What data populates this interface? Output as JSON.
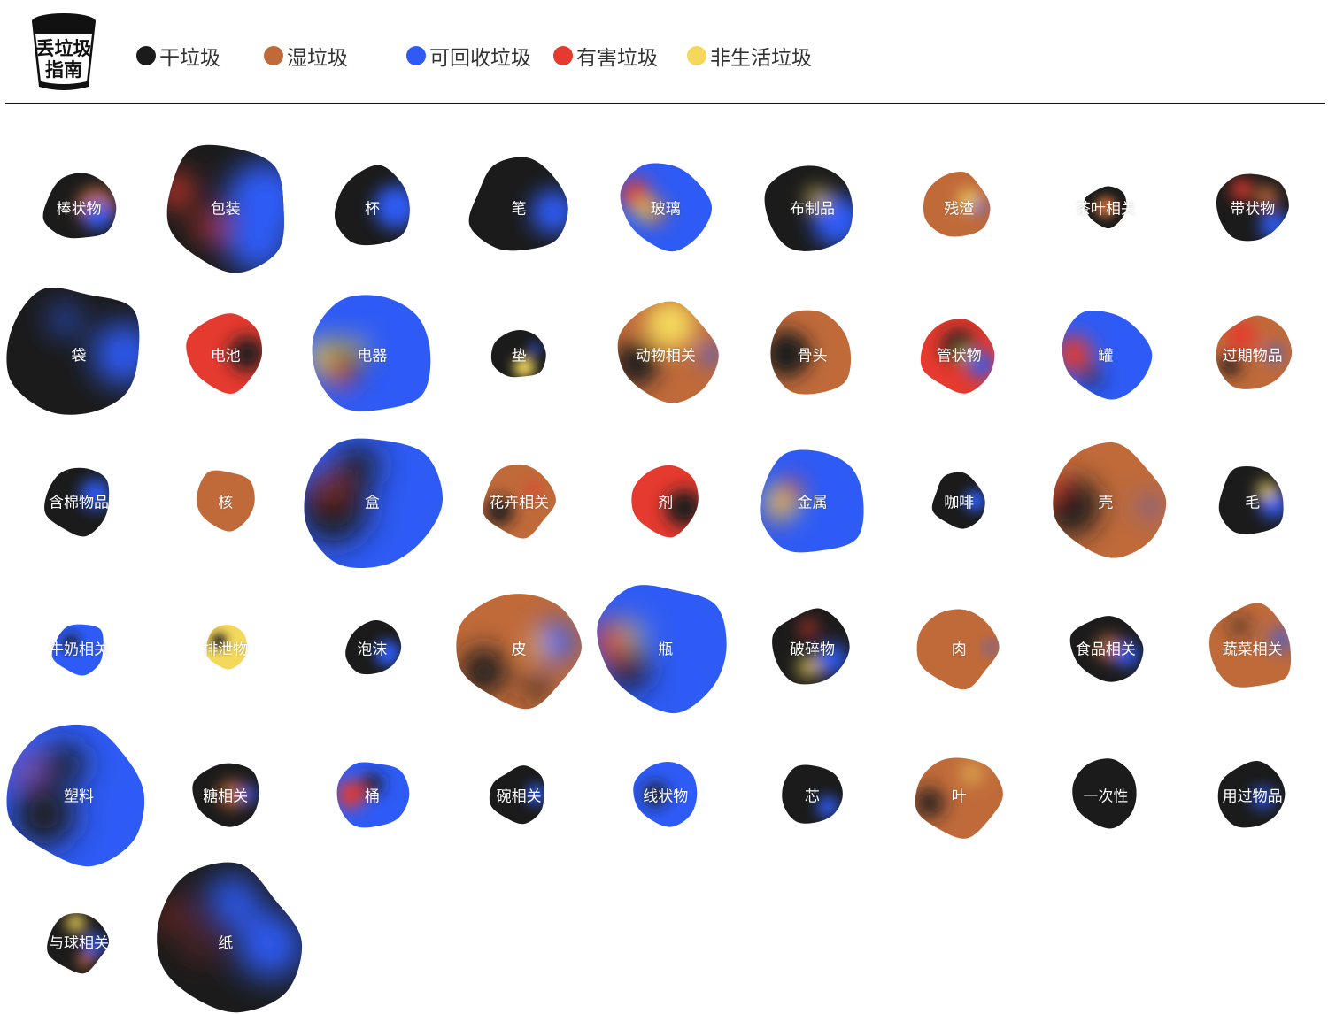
{
  "header": {
    "logo": {
      "line1": "丢垃圾",
      "line2": "指南"
    },
    "legend": [
      {
        "label": "干垃圾",
        "color": "#1b1b1b"
      },
      {
        "label": "湿垃圾",
        "color": "#c06a3a"
      },
      {
        "label": "可回收垃圾",
        "color": "#2e5bf5"
      },
      {
        "label": "有害垃圾",
        "color": "#e53a2f"
      },
      {
        "label": "非生活垃圾",
        "color": "#f4d85c"
      }
    ]
  },
  "colors": {
    "dry": "#1b1b1b",
    "wet": "#c06a3a",
    "recyclable": "#2e5bf5",
    "hazardous": "#e53a2f",
    "non_household": "#f4d85c"
  },
  "items": [
    {
      "label": "棒状物",
      "size": 40,
      "base": "dry",
      "spots": [
        [
          "wet",
          0.5,
          0.0,
          0.55
        ],
        [
          "recyclable",
          0.55,
          0.25,
          0.4
        ]
      ]
    },
    {
      "label": "包装",
      "size": 74,
      "base": "dry",
      "spots": [
        [
          "recyclable",
          0.6,
          -0.1,
          0.6
        ],
        [
          "recyclable",
          0.5,
          0.5,
          0.5
        ],
        [
          "hazardous",
          -0.75,
          -0.25,
          0.25
        ],
        [
          "hazardous",
          -0.25,
          0.3,
          0.2
        ]
      ]
    },
    {
      "label": "杯",
      "size": 45,
      "base": "dry",
      "spots": [
        [
          "recyclable",
          0.6,
          0.0,
          0.55
        ]
      ]
    },
    {
      "label": "笔",
      "size": 56,
      "base": "dry",
      "spots": [
        [
          "recyclable",
          0.7,
          0.1,
          0.45
        ]
      ]
    },
    {
      "label": "玻璃",
      "size": 50,
      "base": "recyclable",
      "spots": [
        [
          "hazardous",
          -0.7,
          -0.3,
          0.35
        ],
        [
          "wet",
          -0.3,
          0.1,
          0.3
        ],
        [
          "non_household",
          -0.5,
          0.05,
          0.2
        ]
      ]
    },
    {
      "label": "布制品",
      "size": 52,
      "base": "dry",
      "spots": [
        [
          "recyclable",
          0.55,
          0.3,
          0.55
        ],
        [
          "non_household",
          0.1,
          -0.2,
          0.2
        ]
      ]
    },
    {
      "label": "残渣",
      "size": 38,
      "base": "wet",
      "spots": [
        [
          "non_household",
          0.3,
          -0.2,
          0.3
        ],
        [
          "recyclable",
          0.6,
          0.0,
          0.2
        ]
      ]
    },
    {
      "label": "茶叶相关",
      "size": 24,
      "base": "dry",
      "spots": [
        [
          "wet",
          0.0,
          0.0,
          0.5
        ]
      ]
    },
    {
      "label": "带状物",
      "size": 40,
      "base": "dry",
      "spots": [
        [
          "hazardous",
          -0.3,
          -0.5,
          0.3
        ],
        [
          "recyclable",
          0.6,
          0.5,
          0.4
        ],
        [
          "wet",
          0.4,
          -0.3,
          0.3
        ]
      ]
    },
    {
      "label": "袋",
      "size": 78,
      "base": "dry",
      "spots": [
        [
          "recyclable",
          0.65,
          0.0,
          0.45
        ],
        [
          "recyclable",
          -0.2,
          -0.5,
          0.2
        ]
      ]
    },
    {
      "label": "电池",
      "size": 45,
      "base": "hazardous",
      "spots": [
        [
          "dry",
          0.55,
          0.0,
          0.45
        ]
      ]
    },
    {
      "label": "电器",
      "size": 68,
      "base": "recyclable",
      "spots": [
        [
          "non_household",
          -0.75,
          0.05,
          0.3
        ],
        [
          "dry",
          -0.45,
          0.1,
          0.3
        ],
        [
          "hazardous",
          -0.55,
          0.35,
          0.2
        ],
        [
          "non_household",
          -0.3,
          -0.1,
          0.15
        ]
      ]
    },
    {
      "label": "垫",
      "size": 30,
      "base": "dry",
      "spots": [
        [
          "non_household",
          0.2,
          0.5,
          0.4
        ],
        [
          "recyclable",
          0.6,
          -0.2,
          0.2
        ]
      ]
    },
    {
      "label": "动物相关",
      "size": 56,
      "base": "wet",
      "spots": [
        [
          "non_household",
          0.1,
          -0.6,
          0.5
        ],
        [
          "dry",
          -0.6,
          0.2,
          0.45
        ],
        [
          "recyclable",
          0.9,
          0.0,
          0.2
        ]
      ]
    },
    {
      "label": "骨头",
      "size": 48,
      "base": "wet",
      "spots": [
        [
          "dry",
          -0.6,
          0.0,
          0.55
        ]
      ]
    },
    {
      "label": "管状物",
      "size": 42,
      "base": "hazardous",
      "spots": [
        [
          "dry",
          0.0,
          -0.2,
          0.45
        ],
        [
          "recyclable",
          0.6,
          0.3,
          0.35
        ],
        [
          "non_household",
          0.15,
          0.0,
          0.15
        ]
      ]
    },
    {
      "label": "罐",
      "size": 52,
      "base": "recyclable",
      "spots": [
        [
          "hazardous",
          -0.7,
          0.0,
          0.4
        ],
        [
          "dry",
          -0.3,
          0.5,
          0.2
        ]
      ]
    },
    {
      "label": "过期物品",
      "size": 42,
      "base": "wet",
      "spots": [
        [
          "hazardous",
          -0.3,
          -0.5,
          0.4
        ],
        [
          "dry",
          -0.6,
          0.3,
          0.3
        ],
        [
          "recyclable",
          0.6,
          0.0,
          0.2
        ]
      ]
    },
    {
      "label": "含棉物品",
      "size": 38,
      "base": "dry",
      "spots": [
        [
          "recyclable",
          0.5,
          -0.2,
          0.45
        ]
      ]
    },
    {
      "label": "核",
      "size": 35,
      "base": "wet",
      "spots": []
    },
    {
      "label": "盒",
      "size": 80,
      "base": "recyclable",
      "spots": [
        [
          "dry",
          -0.55,
          0.1,
          0.5
        ],
        [
          "dry",
          -0.2,
          -0.5,
          0.3
        ],
        [
          "hazardous",
          -0.6,
          -0.2,
          0.12
        ]
      ]
    },
    {
      "label": "花卉相关",
      "size": 40,
      "base": "wet",
      "spots": [
        [
          "dry",
          -0.55,
          0.3,
          0.4
        ],
        [
          "hazardous",
          0.4,
          -0.3,
          0.2
        ]
      ]
    },
    {
      "label": "剂",
      "size": 42,
      "base": "hazardous",
      "spots": [
        [
          "dry",
          0.5,
          0.2,
          0.5
        ]
      ]
    },
    {
      "label": "金属",
      "size": 62,
      "base": "recyclable",
      "spots": [
        [
          "non_household",
          -0.55,
          0.0,
          0.3
        ],
        [
          "hazardous",
          -0.4,
          -0.2,
          0.2
        ],
        [
          "wet",
          -0.65,
          0.3,
          0.15
        ]
      ]
    },
    {
      "label": "咖啡",
      "size": 30,
      "base": "dry",
      "spots": [
        [
          "recyclable",
          0.6,
          0.0,
          0.4
        ]
      ]
    },
    {
      "label": "壳",
      "size": 66,
      "base": "wet",
      "spots": [
        [
          "dry",
          -0.6,
          0.1,
          0.5
        ],
        [
          "hazardous",
          -0.9,
          -0.2,
          0.15
        ],
        [
          "recyclable",
          0.75,
          0.1,
          0.15
        ]
      ]
    },
    {
      "label": "毛",
      "size": 40,
      "base": "dry",
      "spots": [
        [
          "recyclable",
          0.6,
          0.1,
          0.4
        ],
        [
          "non_household",
          0.4,
          -0.3,
          0.25
        ]
      ]
    },
    {
      "label": "牛奶相关",
      "size": 30,
      "base": "recyclable",
      "spots": [
        [
          "dry",
          -0.3,
          -0.2,
          0.3
        ]
      ]
    },
    {
      "label": "排泄物",
      "size": 25,
      "base": "non_household",
      "spots": [
        [
          "dry",
          -0.3,
          -0.3,
          0.35
        ]
      ]
    },
    {
      "label": "泡沫",
      "size": 32,
      "base": "dry",
      "spots": [
        [
          "recyclable",
          0.55,
          0.2,
          0.45
        ]
      ]
    },
    {
      "label": "皮",
      "size": 66,
      "base": "wet",
      "spots": [
        [
          "dry",
          -0.6,
          0.4,
          0.4
        ],
        [
          "recyclable",
          0.6,
          -0.1,
          0.35
        ],
        [
          "non_household",
          0.35,
          -0.05,
          0.15
        ],
        [
          "dry",
          0.3,
          0.7,
          0.2
        ]
      ]
    },
    {
      "label": "瓶",
      "size": 76,
      "base": "recyclable",
      "spots": [
        [
          "hazardous",
          -0.8,
          -0.1,
          0.3
        ],
        [
          "dry",
          -0.55,
          0.35,
          0.3
        ],
        [
          "non_household",
          -0.5,
          -0.2,
          0.15
        ]
      ]
    },
    {
      "label": "破碎物",
      "size": 44,
      "base": "dry",
      "spots": [
        [
          "recyclable",
          0.5,
          0.3,
          0.4
        ],
        [
          "non_household",
          -0.1,
          0.5,
          0.25
        ],
        [
          "hazardous",
          -0.1,
          -0.5,
          0.2
        ]
      ]
    },
    {
      "label": "肉",
      "size": 45,
      "base": "wet",
      "spots": [
        [
          "recyclable",
          0.8,
          0.0,
          0.15
        ]
      ]
    },
    {
      "label": "食品相关",
      "size": 40,
      "base": "dry",
      "spots": [
        [
          "wet",
          0.1,
          0.0,
          0.35
        ],
        [
          "recyclable",
          0.6,
          0.2,
          0.35
        ]
      ]
    },
    {
      "label": "蔬菜相关",
      "size": 48,
      "base": "wet",
      "spots": [
        [
          "recyclable",
          0.7,
          -0.2,
          0.25
        ],
        [
          "dry",
          -0.3,
          -0.5,
          0.2
        ]
      ]
    },
    {
      "label": "塑料",
      "size": 78,
      "base": "recyclable",
      "spots": [
        [
          "dry",
          -0.5,
          0.3,
          0.45
        ],
        [
          "dry",
          -0.2,
          -0.45,
          0.3
        ],
        [
          "hazardous",
          -0.8,
          -0.4,
          0.15
        ]
      ]
    },
    {
      "label": "糖相关",
      "size": 38,
      "base": "dry",
      "spots": [
        [
          "wet",
          0.2,
          0.0,
          0.4
        ],
        [
          "recyclable",
          0.7,
          0.0,
          0.25
        ]
      ]
    },
    {
      "label": "桶",
      "size": 40,
      "base": "recyclable",
      "spots": [
        [
          "hazardous",
          -0.6,
          0.0,
          0.4
        ],
        [
          "dry",
          0.0,
          -0.3,
          0.3
        ]
      ]
    },
    {
      "label": "碗相关",
      "size": 32,
      "base": "dry",
      "spots": [
        [
          "recyclable",
          0.6,
          0.0,
          0.35
        ]
      ]
    },
    {
      "label": "线状物",
      "size": 38,
      "base": "recyclable",
      "spots": [
        [
          "dry",
          -0.3,
          0.0,
          0.35
        ]
      ]
    },
    {
      "label": "芯",
      "size": 35,
      "base": "dry",
      "spots": [
        [
          "recyclable",
          0.5,
          0.4,
          0.35
        ]
      ]
    },
    {
      "label": "叶",
      "size": 48,
      "base": "wet",
      "spots": [
        [
          "dry",
          -0.7,
          0.2,
          0.35
        ],
        [
          "non_household",
          0.3,
          -0.5,
          0.2
        ]
      ]
    },
    {
      "label": "一次性",
      "size": 40,
      "base": "dry",
      "spots": []
    },
    {
      "label": "用过物品",
      "size": 40,
      "base": "dry",
      "spots": [
        [
          "recyclable",
          0.3,
          0.1,
          0.3
        ]
      ]
    },
    {
      "label": "与球相关",
      "size": 35,
      "base": "dry",
      "spots": [
        [
          "recyclable",
          0.5,
          0.1,
          0.35
        ],
        [
          "non_household",
          -0.1,
          -0.6,
          0.3
        ],
        [
          "wet",
          0.2,
          0.6,
          0.25
        ]
      ]
    },
    {
      "label": "纸",
      "size": 84,
      "base": "dry",
      "spots": [
        [
          "recyclable",
          0.6,
          0.05,
          0.45
        ],
        [
          "recyclable",
          0.1,
          -0.55,
          0.35
        ],
        [
          "hazardous",
          -0.7,
          -0.35,
          0.15
        ],
        [
          "hazardous",
          -0.35,
          0.05,
          0.12
        ]
      ]
    }
  ]
}
